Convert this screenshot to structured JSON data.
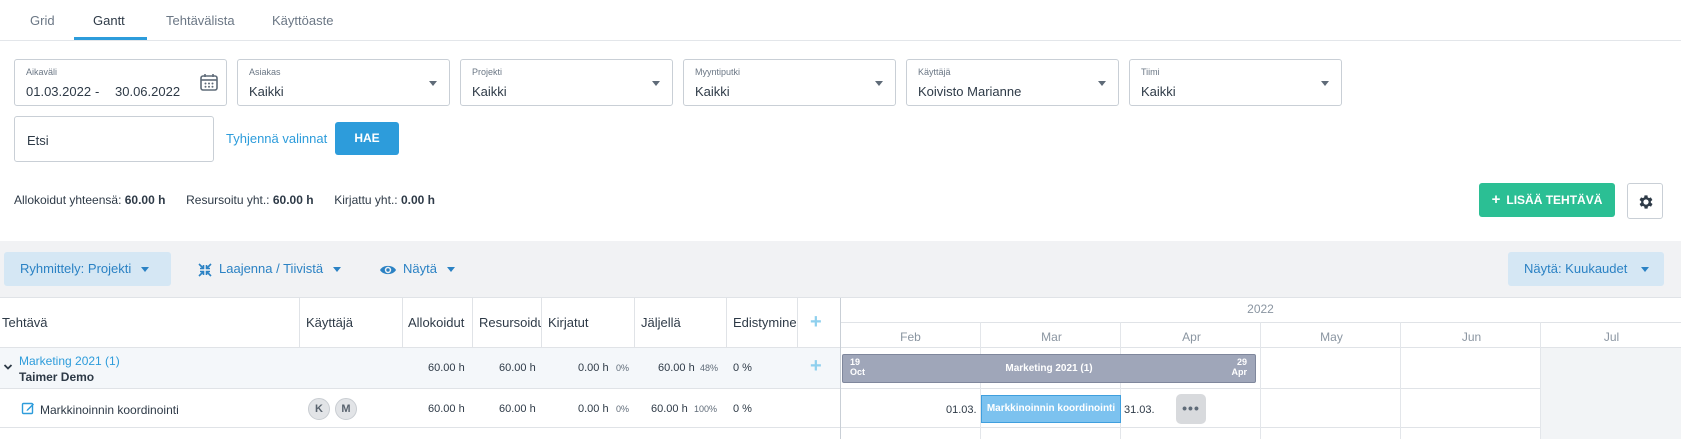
{
  "tabs": [
    {
      "label": "Grid"
    },
    {
      "label": "Gantt"
    },
    {
      "label": "Tehtävälista"
    },
    {
      "label": "Käyttöaste"
    }
  ],
  "active_tab": "Gantt",
  "filters": {
    "date": {
      "label": "Aikaväli",
      "start": "01.03.2022",
      "separator": "-",
      "end": "30.06.2022"
    },
    "client": {
      "label": "Asiakas",
      "value": "Kaikki"
    },
    "project": {
      "label": "Projekti",
      "value": "Kaikki"
    },
    "pipeline": {
      "label": "Myyntiputki",
      "value": "Kaikki"
    },
    "user": {
      "label": "Käyttäjä",
      "value": "Koivisto Marianne"
    },
    "team": {
      "label": "Tiimi",
      "value": "Kaikki"
    }
  },
  "search": {
    "placeholder": "Etsi"
  },
  "clear_label": "Tyhjennä valinnat",
  "search_button": "HAE",
  "totals": {
    "allocated_label": "Allokoidut yhteensä:",
    "allocated_value": "60.00 h",
    "resourced_label": "Resursoitu yht.:",
    "resourced_value": "60.00 h",
    "logged_label": "Kirjattu yht.:",
    "logged_value": "0.00 h"
  },
  "add_task_button": "LISÄÄ TEHTÄVÄ",
  "toolbar": {
    "grouping": "Ryhmittely: Projekti",
    "expand": "Laajenna / Tiivistä",
    "show": "Näytä",
    "view": "Näytä: Kuukaudet"
  },
  "columns": [
    "Tehtävä",
    "Käyttäjä",
    "Allokoidut",
    "Resursoidut",
    "Kirjatut",
    "Jäljellä",
    "Edistyminen"
  ],
  "project_row": {
    "name": "Marketing 2021 (1)",
    "client": "Taimer Demo",
    "allocated": "60.00 h",
    "resourced": "60.00 h",
    "logged": "0.00 h",
    "logged_pct": "0%",
    "remaining": "60.00 h",
    "remaining_pct": "48%",
    "progress": "0 %"
  },
  "task_row": {
    "name": "Markkinoinnin koordinointi",
    "users": [
      "K",
      "M"
    ],
    "allocated": "60.00 h",
    "resourced": "60.00 h",
    "logged": "0.00 h",
    "logged_pct": "0%",
    "remaining": "60.00 h",
    "remaining_pct": "100%",
    "progress": "0 %"
  },
  "gantt": {
    "year": "2022",
    "months": [
      "Feb",
      "Mar",
      "Apr",
      "May",
      "Jun",
      "Jul"
    ],
    "project_bar": {
      "title": "Marketing 2021 (1)",
      "start_day": "19",
      "start_month": "Oct",
      "end_day": "29",
      "end_month": "Apr"
    },
    "task_bar": {
      "title": "Markkinoinnin koordinointi",
      "start": "01.03.",
      "end": "31.03."
    }
  }
}
